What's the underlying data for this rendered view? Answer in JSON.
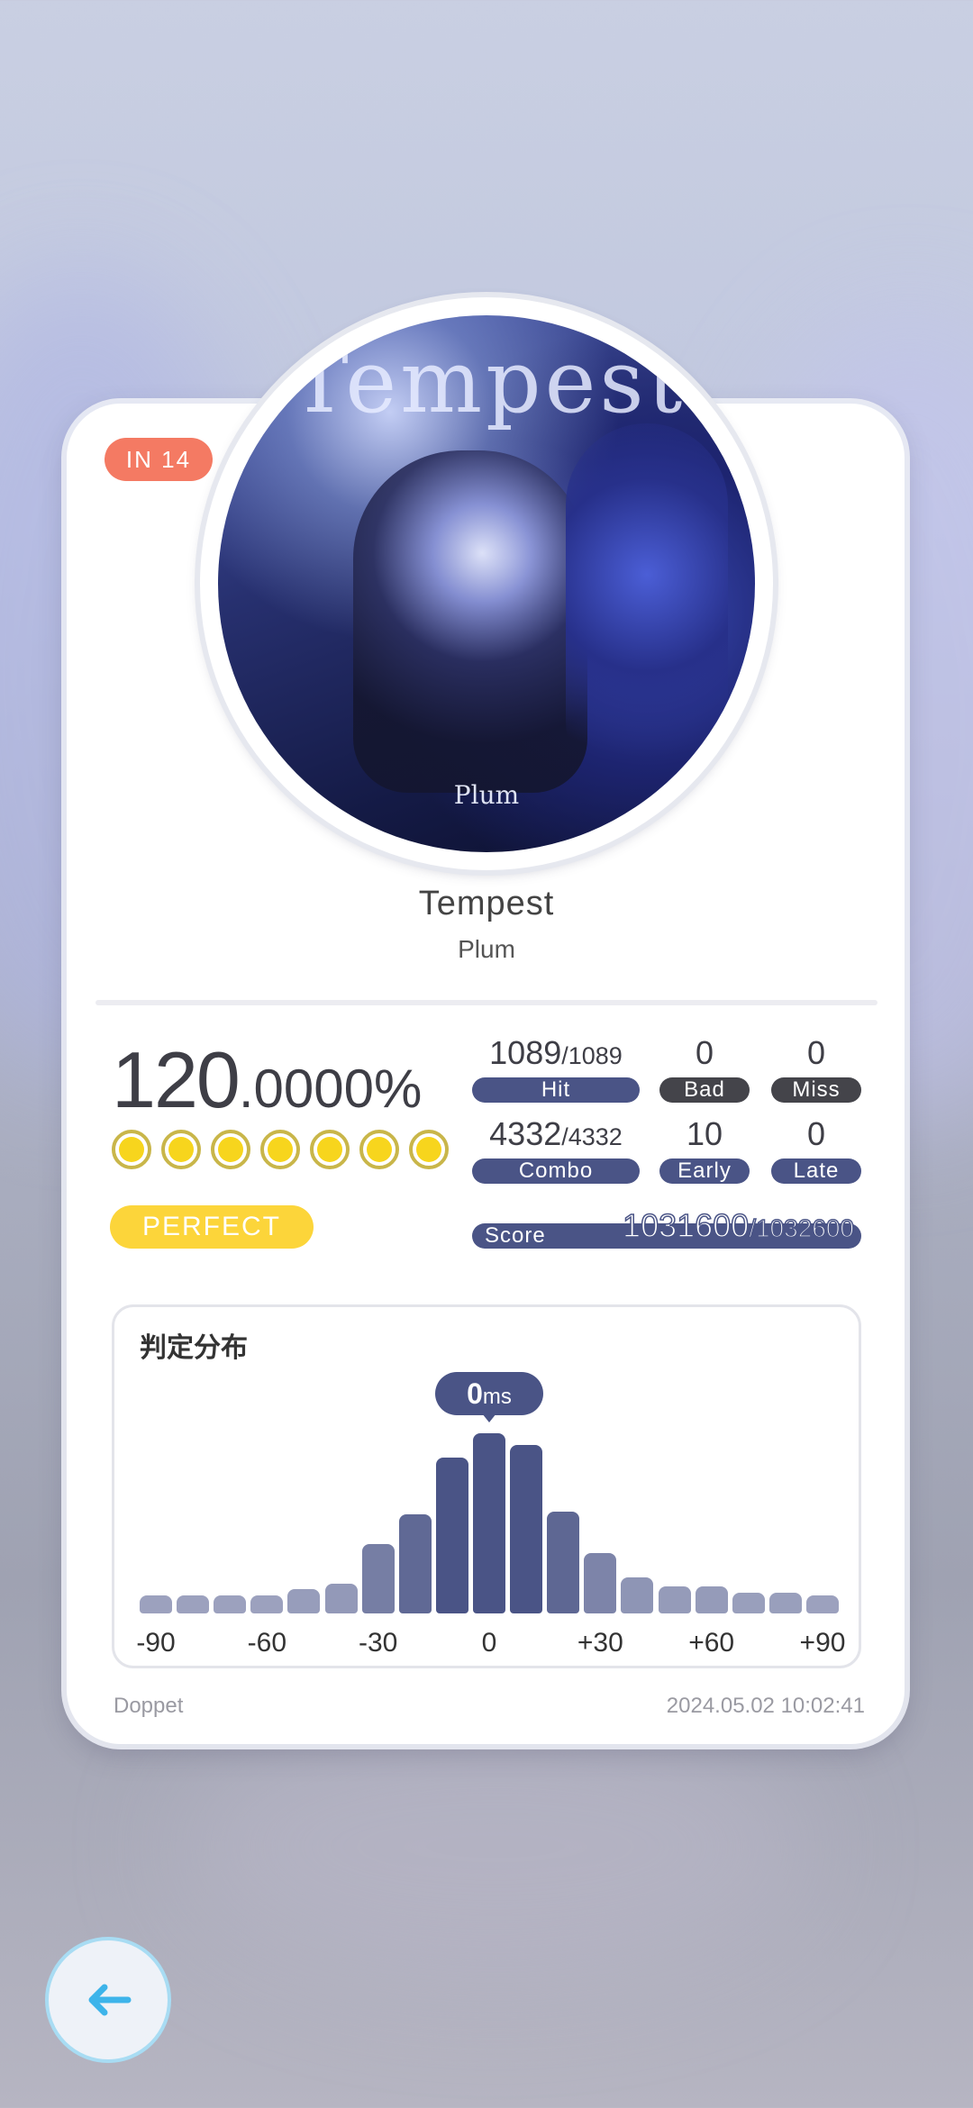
{
  "difficulty_badge": "IN  14",
  "song": {
    "title": "Tempest",
    "artist": "Plum"
  },
  "cover": {
    "title_text": "Tempest",
    "artist_text": "Plum"
  },
  "result": {
    "percent_int": "120",
    "percent_dec": ".0000%",
    "full_dots": 7,
    "rank_label": "PERFECT"
  },
  "stats": {
    "hit": {
      "value": "1089",
      "total": "/1089",
      "label": "Hit"
    },
    "bad": {
      "value": "0",
      "label": "Bad"
    },
    "miss": {
      "value": "0",
      "label": "Miss"
    },
    "combo": {
      "value": "4332",
      "total": "/4332",
      "label": "Combo"
    },
    "early": {
      "value": "10",
      "label": "Early"
    },
    "late": {
      "value": "0",
      "label": "Late"
    },
    "score": {
      "label": "Score",
      "value": "1031600",
      "total": "/1032600"
    }
  },
  "distribution": {
    "title": "判定分布",
    "offset_value": "0",
    "offset_unit": "ms",
    "tick_labels": [
      "-90",
      "-60",
      "-30",
      "0",
      "+30",
      "+60",
      "+90"
    ],
    "bar_levels": [
      0.06,
      0.06,
      0.06,
      0.06,
      0.08,
      0.1,
      0.23,
      0.33,
      0.52,
      0.6,
      0.56,
      0.34,
      0.2,
      0.12,
      0.09,
      0.09,
      0.07,
      0.07,
      0.06
    ],
    "colors": {
      "peak": "#4a5486",
      "low": "#a9aec7"
    }
  },
  "footer": {
    "player": "Doppet",
    "timestamp": "2024.05.02 10:02:41"
  },
  "colors": {
    "badge": "#f47a63",
    "perfect": "#fcd53a",
    "dot": "#f7d51d",
    "pill": "#4a5486",
    "pill_dark": "#44444a"
  },
  "icons": {
    "back": "arrow-left-icon"
  }
}
